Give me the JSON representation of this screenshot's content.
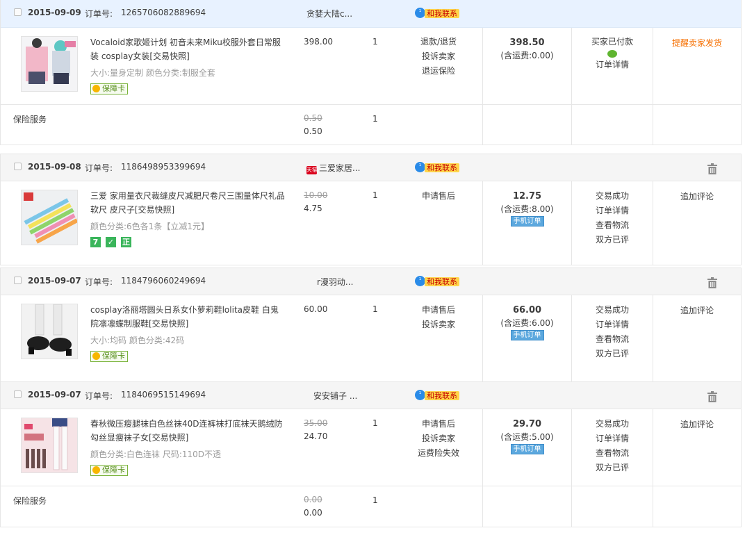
{
  "labels": {
    "order_no": "订单号:",
    "contact": "和我联系",
    "shipping_prefix": "(含运费:",
    "shipping_suffix": ")",
    "mobile_order": "手机订单",
    "insurance": "保险服务"
  },
  "orders": [
    {
      "date": "2015-09-09",
      "order_no": "1265706082889694",
      "shop": "贪婪大陆c...",
      "item": {
        "title": "Vocaloid家歌姬计划 初音未来Miku校服外套日常服装 cosplay女装[交易快照]",
        "meta": "大小:量身定制  颜色分类:制服全套",
        "badge": "保障卡",
        "price": "398.00",
        "qty": "1",
        "actions": [
          "退款/退货",
          "投诉卖家",
          "退运保险"
        ]
      },
      "total": "398.50",
      "shipping": "0.00",
      "status": [
        "买家已付款",
        "订单详情"
      ],
      "op": "提醒卖家发货",
      "service": {
        "orig": "0.50",
        "price": "0.50",
        "qty": "1"
      }
    },
    {
      "date": "2015-09-08",
      "order_no": "1186498953399694",
      "shop": "三爱家居...",
      "shop_icon": "天猫",
      "item": {
        "title": "三爱 家用量衣尺裁缝皮尺减肥尺卷尺三围量体尺礼品软尺 皮尺子[交易快照]",
        "meta": "颜色分类:6色各1条【立减1元】",
        "squares": [
          "7",
          "✓",
          "正"
        ],
        "orig": "10.00",
        "price": "4.75",
        "qty": "1",
        "actions": [
          "申请售后"
        ]
      },
      "total": "12.75",
      "shipping": "8.00",
      "status": [
        "交易成功",
        "订单详情",
        "查看物流",
        "双方已评"
      ],
      "op": "追加评论"
    },
    {
      "date": "2015-09-07",
      "order_no": "1184796060249694",
      "shop": "r漫羽动...",
      "item": {
        "title": "cosplay洛丽塔圆头日系女仆萝莉鞋lolita皮鞋 白鬼院凛凛蝶制服鞋[交易快照]",
        "meta": "大小:均码  颜色分类:42码",
        "badge": "保障卡",
        "price": "60.00",
        "qty": "1",
        "actions": [
          "申请售后",
          "投诉卖家"
        ]
      },
      "total": "66.00",
      "shipping": "6.00",
      "status": [
        "交易成功",
        "订单详情",
        "查看物流",
        "双方已评"
      ],
      "op": "追加评论"
    },
    {
      "date": "2015-09-07",
      "order_no": "1184069515149694",
      "shop": "安安铺子 ...",
      "item": {
        "title": "春秋微压瘦腿袜白色丝袜40D连裤袜打底袜天鹅绒防勾丝显瘦袜子女[交易快照]",
        "meta": "颜色分类:白色连袜  尺码:110D不透",
        "badge": "保障卡",
        "orig": "35.00",
        "price": "24.70",
        "qty": "1",
        "actions": [
          "申请售后",
          "投诉卖家",
          "运费险失效"
        ]
      },
      "total": "29.70",
      "shipping": "5.00",
      "status": [
        "交易成功",
        "订单详情",
        "查看物流",
        "双方已评"
      ],
      "op": "追加评论",
      "service": {
        "orig": "0.00",
        "price": "0.00",
        "qty": "1"
      }
    }
  ]
}
